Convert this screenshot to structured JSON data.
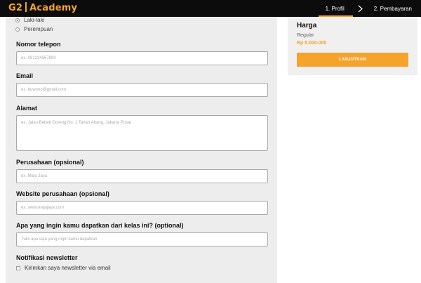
{
  "header": {
    "logo_part1": "G2",
    "logo_part2": "Academy",
    "steps": [
      "1. Profil",
      "2. Pembayaran"
    ],
    "icons": {
      "step_arrow": "chevron-right-icon"
    },
    "colors": {
      "accent": "#f5a32b",
      "bar": "#0c0c0c"
    }
  },
  "form": {
    "gender": {
      "options": [
        {
          "label": "Laki-laki",
          "checked": true
        },
        {
          "label": "Perempuan",
          "checked": false
        }
      ]
    },
    "phone": {
      "label": "Nomor telepon",
      "placeholder": "ex. 0812345678​90"
    },
    "email": {
      "label": "Email",
      "placeholder": "ex. buwono@gmail.com"
    },
    "address": {
      "label": "Alamat",
      "placeholder": "ex. Jalan Bebek Goreng No. 1 Tanah Abang, Jakarta Pusat"
    },
    "company": {
      "label": "Perusahaan (opsional)",
      "placeholder": "ex. Maju Jaya"
    },
    "website": {
      "label": "Website perusahaan (opsional)",
      "placeholder": "ex. www.majujaya.com"
    },
    "expectation": {
      "label": "Apa yang ingin kamu dapatkan dari kelas ini? (optional)",
      "placeholder": "Tulis apa saja yang ingin kamu dapatkan"
    },
    "newsletter": {
      "label": "Notifikasi newsletter",
      "checkbox_label": "Kirimkan saya newsletter via email",
      "checked": false
    }
  },
  "summary": {
    "title": "Harga",
    "tier": "Regular",
    "price": "Rp 5.000.000",
    "button": "LANJUTKAN"
  }
}
